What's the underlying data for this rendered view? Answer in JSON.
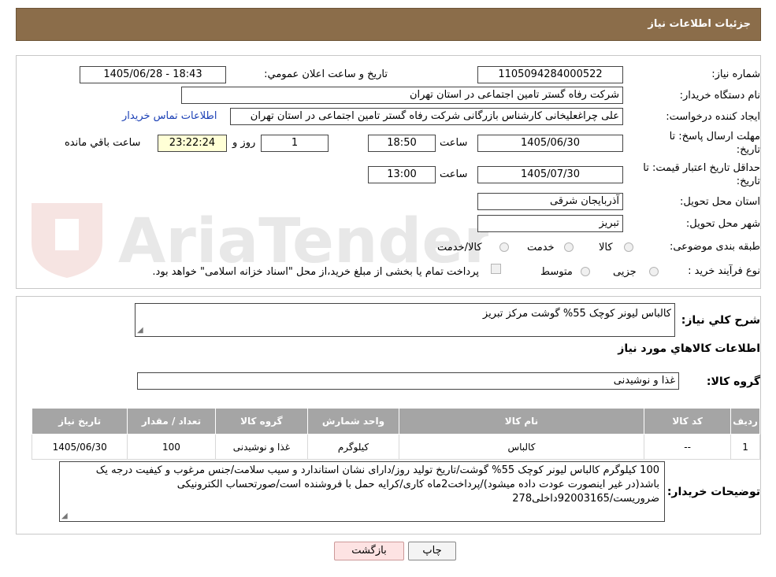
{
  "header": {
    "title": "جزئیات اطلاعات نیاز"
  },
  "watermark": {
    "text": "AriaTender.neT"
  },
  "form": {
    "need_number_label": "شماره نیاز:",
    "need_number": "1105094284000522",
    "announce_label": "تاریخ و ساعت اعلان عمومي:",
    "announce_value": "1405/06/28 - 18:43",
    "buyer_org_label": "نام دستگاه خریدار:",
    "buyer_org": "شرکت رفاه گستر تامین اجتماعی در استان تهران",
    "creator_label": "ایجاد کننده درخواست:",
    "creator": "علی چراغعلیخانی کارشناس بازرگانی شرکت رفاه گستر تامین اجتماعی در استان تهران",
    "contact_link": "اطلاعات تماس خریدار",
    "deadline_label_1": "مهلت ارسال پاسخ: تا",
    "deadline_label_2": "تاریخ:",
    "deadline_date": "1405/06/30",
    "time_label": "ساعت",
    "deadline_time": "18:50",
    "days": "1",
    "days_label": "روز و",
    "remaining": "23:22:24",
    "remaining_label": "ساعت باقي مانده",
    "validity_label_1": "حداقل تاریخ اعتبار قیمت: تا",
    "validity_label_2": "تاریخ:",
    "validity_date": "1405/07/30",
    "validity_time": "13:00",
    "province_label": "استان محل تحویل:",
    "province": "آذربایجان شرقی",
    "city_label": "شهر محل تحویل:",
    "city": "تبریز",
    "category_label": "طبقه بندی موضوعی:",
    "category_options": [
      "کالا",
      "خدمت",
      "کالا/خدمت"
    ],
    "process_label": "نوع فرآیند خرید :",
    "process_options": [
      "جزیی",
      "متوسط"
    ],
    "payment_text": "پرداخت تمام یا بخشی از مبلغ خرید،از محل \"اسناد خزانه اسلامی\" خواهد بود."
  },
  "summary": {
    "description_label": "شرح کلي نياز:",
    "description": "کالباس لیونر کوچک 55% گوشت مرکز تبریز",
    "goods_info_title": "اطلاعات کالاهاي مورد نياز",
    "group_label": "گروه کالا:",
    "group": "غذا و نوشیدنی"
  },
  "table": {
    "headers": [
      "رديف",
      "کد کالا",
      "نام کالا",
      "واحد شمارش",
      "گروه کالا",
      "تعداد / مقدار",
      "تاريخ نياز"
    ],
    "rows": [
      [
        "1",
        "--",
        "کالباس",
        "کیلوگرم",
        "غذا و نوشیدنی",
        "100",
        "1405/06/30"
      ]
    ]
  },
  "notes": {
    "label": "توضیحات خریدار:",
    "text": "100 کیلوگرم کالباس لیونر کوچک 55% گوشت/تاریخ تولید روز/دارای نشان استاندارد و سیب سلامت/جنس مرغوب و کیفیت درجه یک باشد(در غیر اینصورت عودت داده میشود)/پرداخت2ماه کاری/کرایه حمل با فروشنده است/صورتحساب الکترونیکی ضروریست/92003165داخلی278"
  },
  "buttons": {
    "print": "چاپ",
    "back": "بازگشت"
  }
}
